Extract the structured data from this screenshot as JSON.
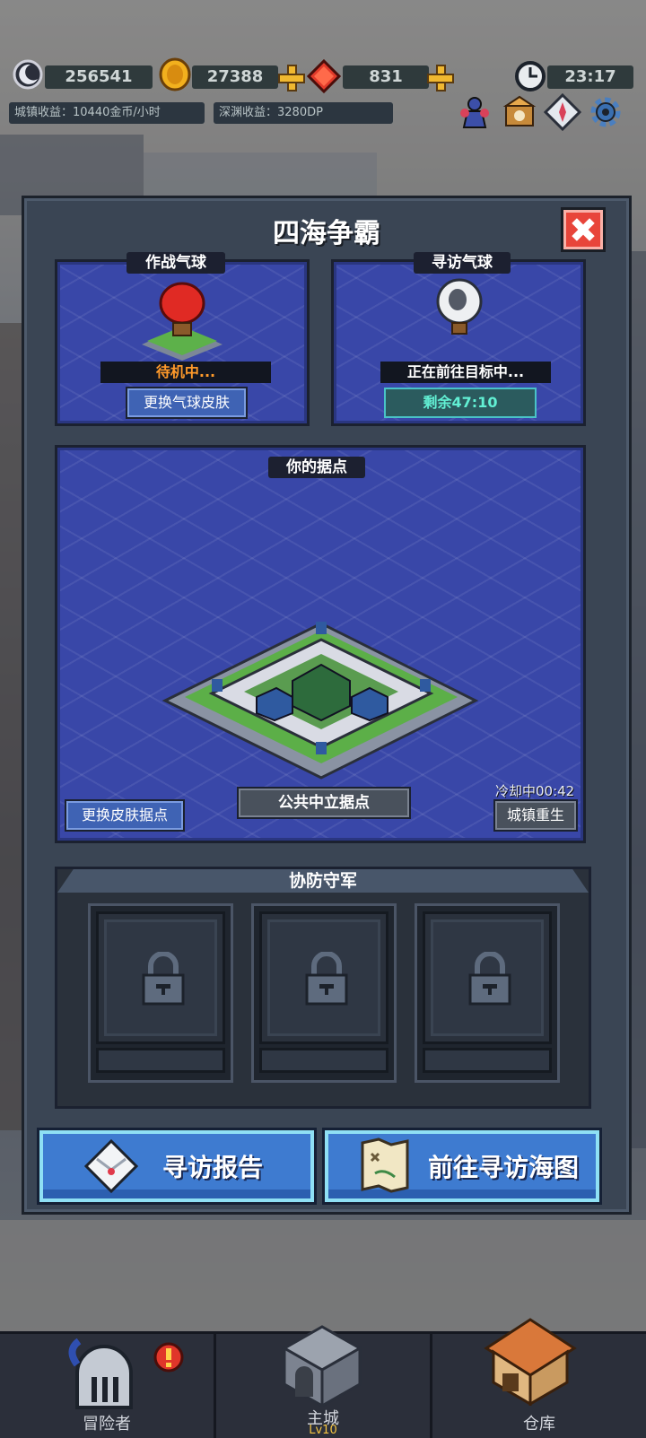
{
  "hud": {
    "dp_value": "256541",
    "gold_value": "27388",
    "gem_value": "831",
    "time": "23:17",
    "town_income": "城镇收益：10440金币/小时",
    "abyss_income": "深渊收益：3280DP"
  },
  "panel": {
    "title": "四海争霸"
  },
  "battle_balloon": {
    "tag": "作战气球",
    "status": "待机中...",
    "skin_button": "更换气球皮肤"
  },
  "visit_balloon": {
    "tag": "寻访气球",
    "status": "正在前往目标中...",
    "remaining": "剩余47:10"
  },
  "stronghold": {
    "tag": "你的据点",
    "name": "公共中立据点",
    "skin_button": "更换皮肤据点",
    "cooldown": "冷却中00:42",
    "rebirth_button": "城镇重生"
  },
  "defense": {
    "title": "协防守军",
    "slots": [
      {
        "locked": true
      },
      {
        "locked": true
      },
      {
        "locked": true
      }
    ]
  },
  "actions": {
    "report": "寻访报告",
    "map": "前往寻访海图"
  },
  "nav": {
    "adventurer": "冒险者",
    "main_city": "主城",
    "main_city_level": "Lv10",
    "warehouse": "仓库"
  },
  "colors": {
    "sea": "#3947a8",
    "accent_orange": "#ff9a2a",
    "accent_teal": "#62f0d4"
  }
}
